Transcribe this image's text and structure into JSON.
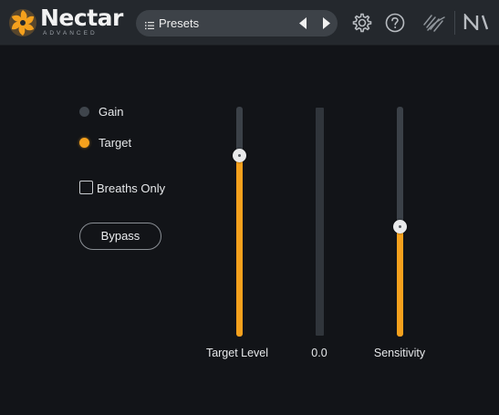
{
  "header": {
    "brand": "Nectar",
    "brand_sub": "ADVANCED",
    "preset_label": "Presets",
    "icons": [
      "nectar-logo-icon",
      "list-icon",
      "chevron-left-icon",
      "chevron-right-icon",
      "gear-icon",
      "help-icon",
      "link-icon",
      "native-instruments-icon"
    ]
  },
  "mode": {
    "options": [
      {
        "label": "Gain",
        "selected": false
      },
      {
        "label": "Target",
        "selected": true
      }
    ]
  },
  "breaths_only": {
    "label": "Breaths Only",
    "checked": false
  },
  "bypass": {
    "label": "Bypass"
  },
  "sliders": {
    "target_level": {
      "label": "Target Level",
      "level": 0.79
    },
    "meter": {
      "value_label": "0.0",
      "level": 0.0
    },
    "sensitivity": {
      "label": "Sensitivity",
      "level": 0.48
    }
  },
  "colors": {
    "accent": "#f5a11d",
    "background": "#121418",
    "header": "#24282d",
    "track": "#3b4148"
  }
}
